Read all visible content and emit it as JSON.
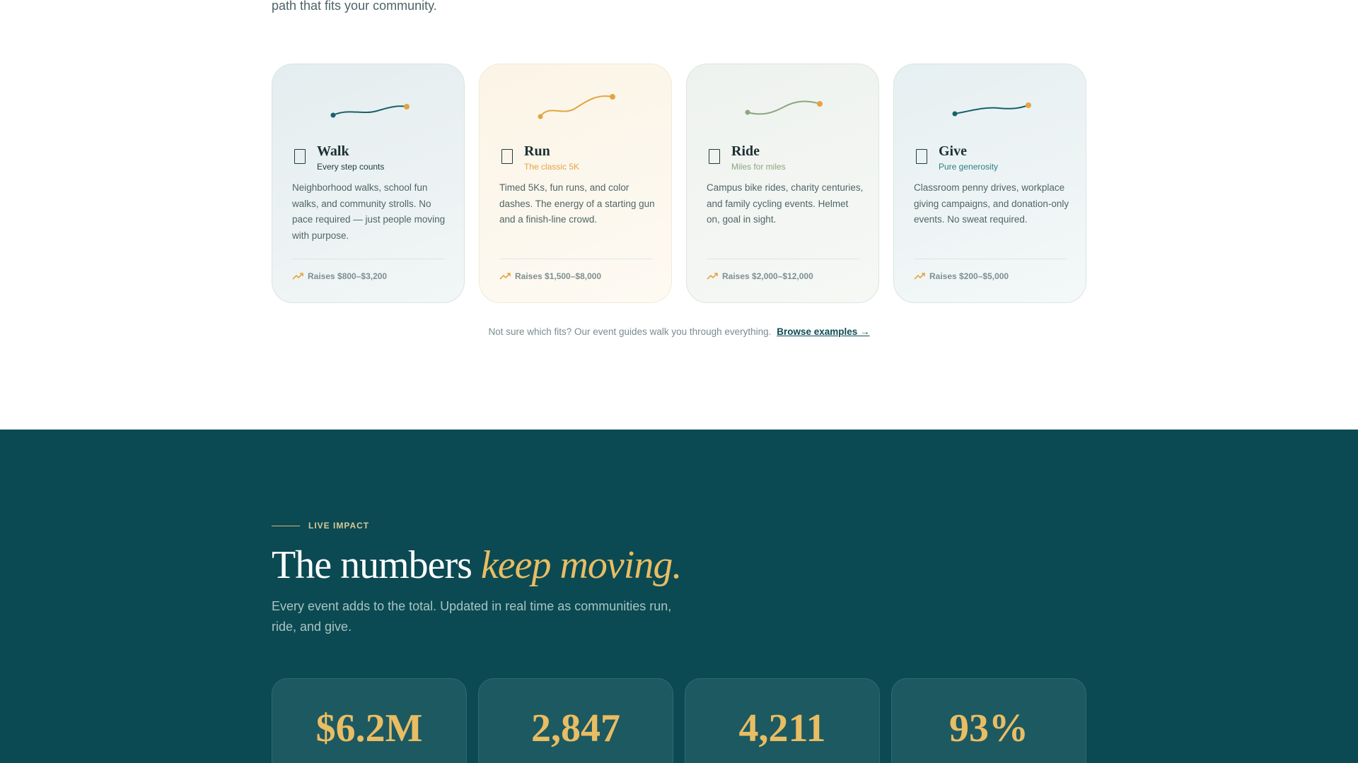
{
  "intro": {
    "text": "path that fits your community."
  },
  "cards": [
    {
      "title": "Walk",
      "subtitle": "Every step counts",
      "subtitle_color": "#1f3a3d",
      "description": "Neighborhood walks, school fun walks, and community strolls. No pace required — just people moving with purpose.",
      "raise": "Raises $800–$3,200",
      "line_color": "#17626a",
      "icon": "walk-icon"
    },
    {
      "title": "Run",
      "subtitle": "The classic 5K",
      "subtitle_color": "#e3a543",
      "description": "Timed 5Ks, fun runs, and color dashes. The energy of a starting gun and a finish-line crowd.",
      "raise": "Raises $1,500–$8,000",
      "line_color": "#e3a543",
      "icon": "run-icon"
    },
    {
      "title": "Ride",
      "subtitle": "Miles for miles",
      "subtitle_color": "#8aa67e",
      "description": "Campus bike rides, charity centuries, and family cycling events. Helmet on, goal in sight.",
      "raise": "Raises $2,000–$12,000",
      "line_color": "#8aa67e",
      "icon": "ride-icon"
    },
    {
      "title": "Give",
      "subtitle": "Pure generosity",
      "subtitle_color": "#2e7e86",
      "description": "Classroom penny drives, workplace giving campaigns, and donation-only events. No sweat required.",
      "raise": "Raises $200–$5,000",
      "line_color": "#17626a",
      "icon": "give-icon"
    }
  ],
  "guide": {
    "text": "Not sure which fits? Our event guides walk you through everything.",
    "link": "Browse examples →"
  },
  "impact": {
    "eyebrow": "LIVE IMPACT",
    "title_plain": "The numbers ",
    "title_accent": "keep moving.",
    "lede": "Every event adds to the total. Updated in real time as communities run, ride, and give.",
    "stats": [
      {
        "value": "$6.2M"
      },
      {
        "value": "2,847"
      },
      {
        "value": "4,211"
      },
      {
        "value": "93%"
      }
    ]
  },
  "colors": {
    "accent": "#e9bd63",
    "brand": "#0b4a52"
  }
}
